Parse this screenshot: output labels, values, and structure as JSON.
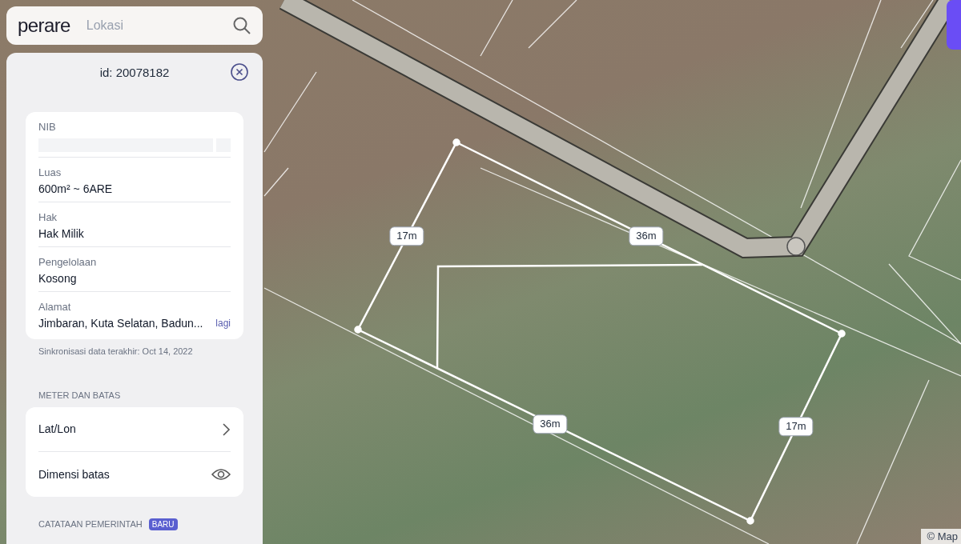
{
  "search": {
    "logo": "perare",
    "placeholder": "Lokasi"
  },
  "panel": {
    "title": "id: 20078182",
    "fields": [
      {
        "kind": "redacted",
        "label": "NIB"
      },
      {
        "kind": "text",
        "label": "Luas",
        "value": "600m² ~ 6ARE"
      },
      {
        "kind": "text",
        "label": "Hak",
        "value": "Hak Milik"
      },
      {
        "kind": "text",
        "label": "Pengelolaan",
        "value": "Kosong"
      },
      {
        "kind": "text",
        "label": "Alamat",
        "value": "Jimbaran, Kuta Selatan, Badun...",
        "more": "lagi"
      }
    ],
    "sync_note": "Sinkronisasi data terakhir: Oct 14, 2022",
    "section": {
      "heading": "METER DAN BATAS",
      "items": [
        {
          "label": "Lat/Lon",
          "kind": "link"
        },
        {
          "label": "Dimensi batas",
          "kind": "toggle"
        }
      ]
    },
    "notes_heading": "CATATAAN PEMERINTAH",
    "notes_badge": "BARU"
  },
  "map": {
    "dimension_labels": [
      "17m",
      "36m",
      "36m",
      "17m"
    ],
    "attribution": "© Map"
  }
}
